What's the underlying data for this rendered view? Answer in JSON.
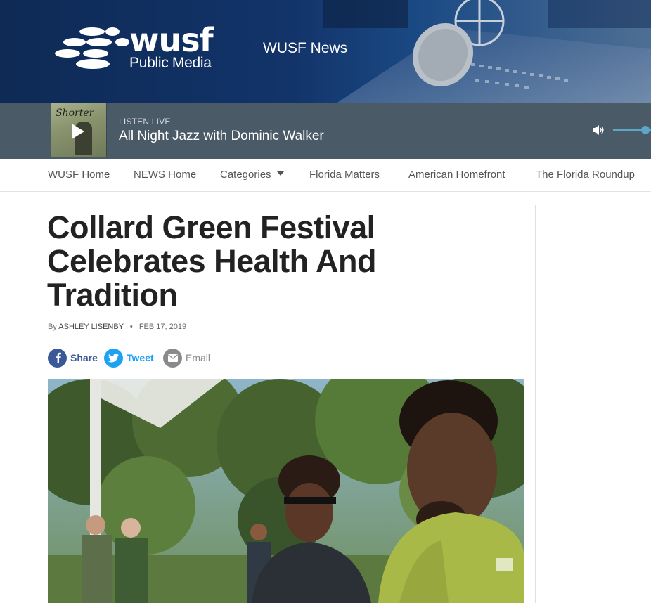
{
  "header": {
    "logo_word": "wusf",
    "logo_sub": "Public Media",
    "site_name": "WUSF News"
  },
  "player": {
    "album_title": "Shorter",
    "listen_label": "LISTEN LIVE",
    "show_name": "All Night Jazz with Dominic Walker",
    "accent": "#5ea6c9"
  },
  "nav": {
    "items": [
      "WUSF Home",
      "NEWS Home",
      "Categories",
      "Florida Matters",
      "American Homefront",
      "The Florida Roundup"
    ]
  },
  "article": {
    "headline": "Collard Green Festival Celebrates Health And Tradition",
    "by_prefix": "By",
    "author": "ASHLEY LISENBY",
    "date": "FEB 17, 2019"
  },
  "share": {
    "facebook_label": "Share",
    "twitter_label": "Tweet",
    "email_label": "Email",
    "facebook_color": "#3b5998",
    "twitter_color": "#1da1f2",
    "email_color": "#8a8a8a"
  }
}
